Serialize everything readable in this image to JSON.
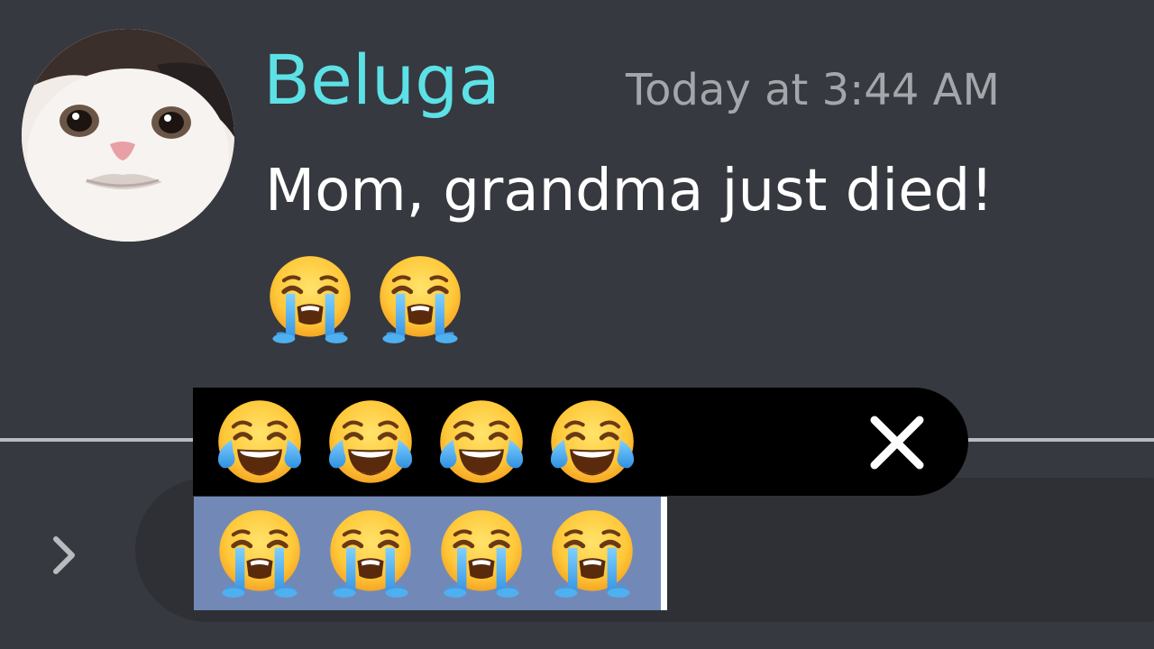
{
  "message": {
    "username": "Beluga",
    "timestamp": "Today at 3:44 AM",
    "text": "Mom, grandma just died!",
    "reactions": [
      "loudly-crying-face-emoji",
      "loudly-crying-face-emoji"
    ]
  },
  "suggestion_bar": {
    "emojis": [
      "face-with-tears-of-joy-emoji",
      "face-with-tears-of-joy-emoji",
      "face-with-tears-of-joy-emoji",
      "face-with-tears-of-joy-emoji"
    ],
    "close_icon": "close-icon"
  },
  "composer": {
    "expand_icon": "chevron-right-icon",
    "selected_emojis": [
      "loudly-crying-face-emoji",
      "loudly-crying-face-emoji",
      "loudly-crying-face-emoji",
      "loudly-crying-face-emoji"
    ]
  },
  "colors": {
    "background": "#36393f",
    "username": "#5ce1e6",
    "timestamp": "#a3a6aa",
    "selection": "#7289b8",
    "suggestion_bar": "#000000"
  }
}
